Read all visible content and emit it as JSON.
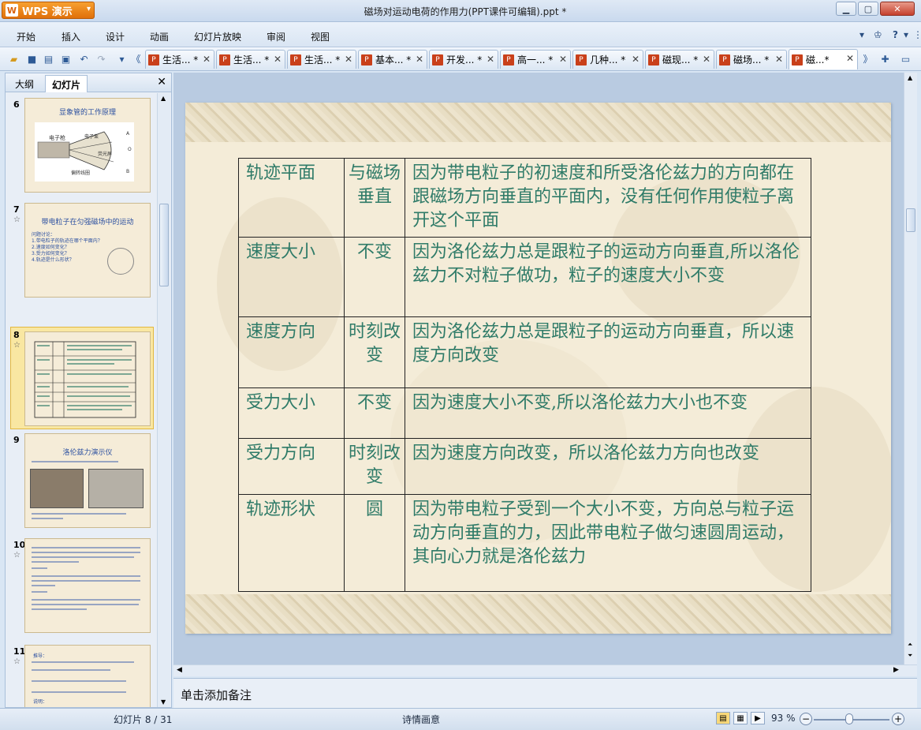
{
  "app": {
    "name": "WPS 演示",
    "window_title": "磁场对运动电荷的作用力(PPT课件可编辑).ppt *"
  },
  "menu": [
    "开始",
    "插入",
    "设计",
    "动画",
    "幻灯片放映",
    "审阅",
    "视图"
  ],
  "menu_right": {
    "help": "?"
  },
  "tabs": [
    {
      "label": "生活... *"
    },
    {
      "label": "生活... *"
    },
    {
      "label": "生活... *"
    },
    {
      "label": "基本... *"
    },
    {
      "label": "开发... *"
    },
    {
      "label": "高一... *"
    },
    {
      "label": "几种... *"
    },
    {
      "label": "磁现... *"
    },
    {
      "label": "磁场... *"
    },
    {
      "label": "磁...*",
      "active": true
    }
  ],
  "side_tabs": {
    "outline": "大纲",
    "slides": "幻灯片"
  },
  "thumbnails": [
    {
      "num": "6",
      "title": "显象管的工作原理",
      "labels": [
        "电子枪",
        "电子束",
        "荧光屏",
        "偏转线圈",
        "A",
        "O",
        "B"
      ]
    },
    {
      "num": "7",
      "title": "带电粒子在匀强磁场中的运动",
      "lines": [
        "问题讨论：",
        "1.带电粒子的轨迹在哪个平面内？",
        "2.速度如何变化？",
        "3.受力如何变化？",
        "4.轨迹是什么形状？"
      ]
    },
    {
      "num": "8",
      "selected": true
    },
    {
      "num": "9",
      "title": "洛伦兹力演示仪"
    },
    {
      "num": "10"
    },
    {
      "num": "11",
      "lines": [
        "推导：",
        "说明："
      ]
    }
  ],
  "slide_table": [
    {
      "item": "轨迹平面",
      "result": "与磁场垂直",
      "reason": "因为带电粒子的初速度和所受洛伦兹力的方向都在跟磁场方向垂直的平面内，没有任何作用使粒子离开这个平面"
    },
    {
      "item": "速度大小",
      "result": "不变",
      "reason": "因为洛伦兹力总是跟粒子的运动方向垂直,所以洛伦兹力不对粒子做功，粒子的速度大小不变"
    },
    {
      "item": "速度方向",
      "result": "时刻改变",
      "reason": "因为洛伦兹力总是跟粒子的运动方向垂直，所以速度方向改变"
    },
    {
      "item": "受力大小",
      "result": "不变",
      "reason": "因为速度大小不变,所以洛伦兹力大小也不变"
    },
    {
      "item": "受力方向",
      "result": "时刻改变",
      "reason": "因为速度方向改变，所以洛伦兹力方向也改变"
    },
    {
      "item": "轨迹形状",
      "result": "圆",
      "reason": "因为带电粒子受到一个大小不变，方向总与粒子运动方向垂直的力，因此带电粒子做匀速圆周运动，其向心力就是洛伦兹力"
    }
  ],
  "notes_placeholder": "单击添加备注",
  "status": {
    "slide_count": "幻灯片 8 / 31",
    "theme": "诗情画意",
    "zoom": "93 %"
  },
  "colors": {
    "accent": "#e0700a",
    "slide_text": "#2f7b68",
    "selection": "#f9e7a2"
  }
}
